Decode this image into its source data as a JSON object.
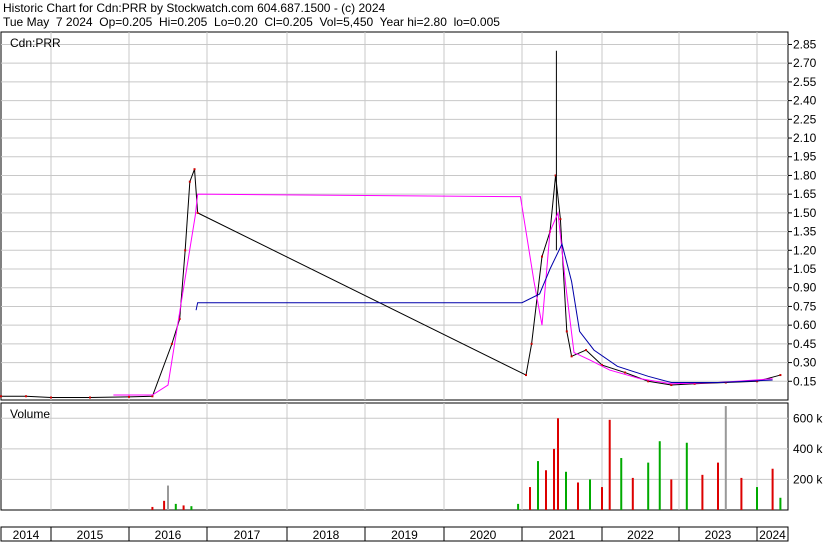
{
  "header": {
    "line1": "Historic Chart for Cdn:PRR by Stockwatch.com 604.687.1500 - (c) 2024",
    "line2": "Tue May  7 2024  Op=0.205  Hi=0.205  Lo=0.20  Cl=0.205  Vol=5,450  Year hi=2.80  lo=0.005"
  },
  "chart_data": [
    {
      "type": "line",
      "panel_label": "Cdn:PRR",
      "x_categories": [
        "2014",
        "2015",
        "2016",
        "2017",
        "2018",
        "2019",
        "2020",
        "2021",
        "2022",
        "2023",
        "2024"
      ],
      "y_ticks": [
        "2.85",
        "2.70",
        "2.55",
        "2.40",
        "2.25",
        "2.10",
        "1.95",
        "1.80",
        "1.65",
        "1.50",
        "1.35",
        "1.20",
        "1.05",
        "0.90",
        "0.75",
        "0.60",
        "0.45",
        "0.30",
        "0.15"
      ],
      "ylim": [
        0,
        2.95
      ],
      "grid": true,
      "colors": {
        "price": "#000000",
        "price_up": "#000000",
        "price_down": "#cc0000",
        "ma_short": "#ff00ff",
        "ma_long": "#0000aa"
      },
      "price_points": [
        {
          "date": "2014.0",
          "close": 0.03
        },
        {
          "date": "2014.5",
          "close": 0.03
        },
        {
          "date": "2015.0",
          "close": 0.02
        },
        {
          "date": "2015.5",
          "close": 0.02
        },
        {
          "date": "2016.0",
          "close": 0.025
        },
        {
          "date": "2016.3",
          "close": 0.03
        },
        {
          "date": "2016.55",
          "close": 0.45
        },
        {
          "date": "2016.65",
          "close": 0.65
        },
        {
          "date": "2016.72",
          "close": 1.2
        },
        {
          "date": "2016.78",
          "close": 1.75
        },
        {
          "date": "2016.84",
          "close": 1.85
        },
        {
          "date": "2016.88",
          "close": 1.5
        },
        {
          "date": "2021.05",
          "close": 0.2
        },
        {
          "date": "2021.12",
          "close": 0.45
        },
        {
          "date": "2021.25",
          "close": 1.15
        },
        {
          "date": "2021.35",
          "close": 1.35
        },
        {
          "date": "2021.42",
          "close": 1.8
        },
        {
          "date": "2021.48",
          "close": 1.45
        },
        {
          "date": "2021.56",
          "close": 0.55
        },
        {
          "date": "2021.62",
          "close": 0.35
        },
        {
          "date": "2021.8",
          "close": 0.4
        },
        {
          "date": "2022.0",
          "close": 0.28
        },
        {
          "date": "2022.3",
          "close": 0.22
        },
        {
          "date": "2022.6",
          "close": 0.15
        },
        {
          "date": "2022.9",
          "close": 0.12
        },
        {
          "date": "2023.2",
          "close": 0.13
        },
        {
          "date": "2023.6",
          "close": 0.14
        },
        {
          "date": "2024.0",
          "close": 0.15
        },
        {
          "date": "2024.3",
          "close": 0.2
        }
      ],
      "price_high_spike": {
        "date": "2021.43",
        "high": 2.8
      },
      "ma_short_points": [
        {
          "date": "2015.8",
          "v": 0.04
        },
        {
          "date": "2016.3",
          "v": 0.04
        },
        {
          "date": "2016.5",
          "v": 0.12
        },
        {
          "date": "2016.7",
          "v": 0.9
        },
        {
          "date": "2016.85",
          "v": 1.48
        },
        {
          "date": "2016.88",
          "v": 1.65
        },
        {
          "date": "2020.98",
          "v": 1.63
        },
        {
          "date": "2021.15",
          "v": 0.95
        },
        {
          "date": "2021.25",
          "v": 0.6
        },
        {
          "date": "2021.35",
          "v": 1.35
        },
        {
          "date": "2021.45",
          "v": 1.5
        },
        {
          "date": "2021.55",
          "v": 0.9
        },
        {
          "date": "2021.65",
          "v": 0.38
        },
        {
          "date": "2021.85",
          "v": 0.32
        },
        {
          "date": "2022.1",
          "v": 0.24
        },
        {
          "date": "2022.5",
          "v": 0.17
        },
        {
          "date": "2022.9",
          "v": 0.13
        },
        {
          "date": "2023.5",
          "v": 0.14
        },
        {
          "date": "2024.2",
          "v": 0.17
        }
      ],
      "ma_long_points": [
        {
          "date": "2016.86",
          "v": 0.72
        },
        {
          "date": "2016.88",
          "v": 0.78
        },
        {
          "date": "2021.0",
          "v": 0.78
        },
        {
          "date": "2021.22",
          "v": 0.85
        },
        {
          "date": "2021.35",
          "v": 1.05
        },
        {
          "date": "2021.5",
          "v": 1.25
        },
        {
          "date": "2021.62",
          "v": 0.95
        },
        {
          "date": "2021.72",
          "v": 0.55
        },
        {
          "date": "2021.9",
          "v": 0.4
        },
        {
          "date": "2022.2",
          "v": 0.27
        },
        {
          "date": "2022.6",
          "v": 0.19
        },
        {
          "date": "2022.9",
          "v": 0.14
        },
        {
          "date": "2023.5",
          "v": 0.14
        },
        {
          "date": "2024.2",
          "v": 0.16
        }
      ]
    },
    {
      "type": "bar",
      "panel_label": "Volume",
      "y_ticks": [
        "600 k",
        "400 k",
        "200 k"
      ],
      "ylim": [
        0,
        700000
      ],
      "grid": true,
      "colors": {
        "up": "#00aa00",
        "down": "#dd0000",
        "neutral": "#999999"
      },
      "volume_bars": [
        {
          "date": "2016.3",
          "v": 20000,
          "c": "down"
        },
        {
          "date": "2016.45",
          "v": 60000,
          "c": "down"
        },
        {
          "date": "2016.5",
          "v": 160000,
          "c": "neutral"
        },
        {
          "date": "2016.6",
          "v": 40000,
          "c": "up"
        },
        {
          "date": "2016.7",
          "v": 30000,
          "c": "down"
        },
        {
          "date": "2016.8",
          "v": 25000,
          "c": "up"
        },
        {
          "date": "2020.95",
          "v": 40000,
          "c": "up"
        },
        {
          "date": "2021.1",
          "v": 150000,
          "c": "down"
        },
        {
          "date": "2021.2",
          "v": 320000,
          "c": "up"
        },
        {
          "date": "2021.3",
          "v": 260000,
          "c": "down"
        },
        {
          "date": "2021.4",
          "v": 400000,
          "c": "down"
        },
        {
          "date": "2021.45",
          "v": 600000,
          "c": "down"
        },
        {
          "date": "2021.55",
          "v": 250000,
          "c": "up"
        },
        {
          "date": "2021.7",
          "v": 180000,
          "c": "down"
        },
        {
          "date": "2021.85",
          "v": 200000,
          "c": "up"
        },
        {
          "date": "2022.0",
          "v": 150000,
          "c": "down"
        },
        {
          "date": "2022.1",
          "v": 590000,
          "c": "down"
        },
        {
          "date": "2022.25",
          "v": 340000,
          "c": "up"
        },
        {
          "date": "2022.4",
          "v": 210000,
          "c": "down"
        },
        {
          "date": "2022.6",
          "v": 310000,
          "c": "up"
        },
        {
          "date": "2022.75",
          "v": 450000,
          "c": "up"
        },
        {
          "date": "2022.9",
          "v": 200000,
          "c": "down"
        },
        {
          "date": "2023.1",
          "v": 440000,
          "c": "up"
        },
        {
          "date": "2023.3",
          "v": 230000,
          "c": "down"
        },
        {
          "date": "2023.5",
          "v": 310000,
          "c": "down"
        },
        {
          "date": "2023.6",
          "v": 680000,
          "c": "neutral"
        },
        {
          "date": "2023.8",
          "v": 210000,
          "c": "down"
        },
        {
          "date": "2024.0",
          "v": 150000,
          "c": "up"
        },
        {
          "date": "2024.2",
          "v": 270000,
          "c": "down"
        },
        {
          "date": "2024.3",
          "v": 80000,
          "c": "up"
        }
      ]
    }
  ]
}
